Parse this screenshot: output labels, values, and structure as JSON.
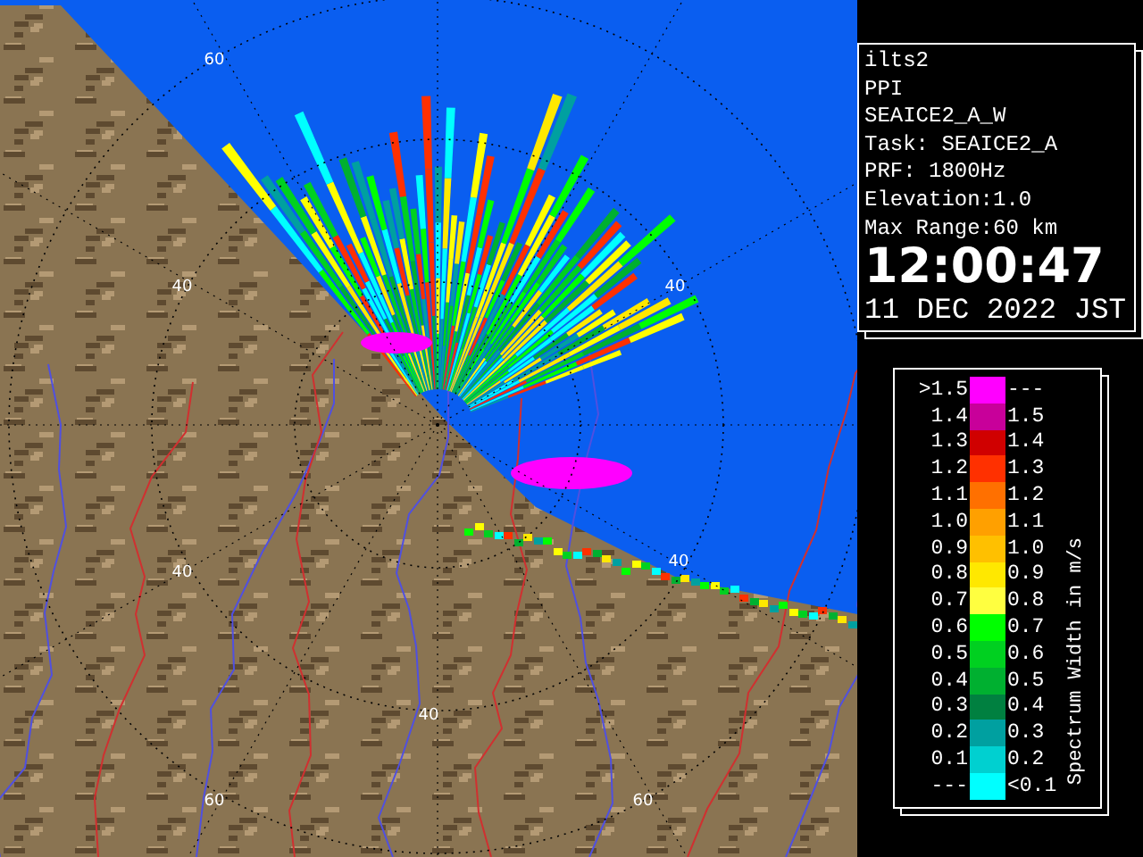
{
  "map": {
    "range_labels": [
      "60",
      "40",
      "40",
      "40",
      "40",
      "40",
      "60",
      "60"
    ]
  },
  "info": {
    "lines": [
      "ilts2",
      "PPI",
      "SEAICE2_A_W",
      "Task: SEAICE2_A",
      "PRF: 1800Hz",
      "Elevation:1.0",
      "Max Range:60 km"
    ],
    "time": "12:00:47",
    "date": "11 DEC 2022 JST"
  },
  "legend": {
    "title": "Spectrum Width in m/s",
    "rows": [
      {
        "low": ">1.5",
        "high": "---",
        "color": "#ff00ff"
      },
      {
        "low": "1.4",
        "high": "1.5",
        "color": "#c8009a"
      },
      {
        "low": "1.3",
        "high": "1.4",
        "color": "#d00000"
      },
      {
        "low": "1.2",
        "high": "1.3",
        "color": "#ff3000"
      },
      {
        "low": "1.1",
        "high": "1.2",
        "color": "#ff7000"
      },
      {
        "low": "1.0",
        "high": "1.1",
        "color": "#ffa000"
      },
      {
        "low": "0.9",
        "high": "1.0",
        "color": "#ffc000"
      },
      {
        "low": "0.8",
        "high": "0.9",
        "color": "#ffe800"
      },
      {
        "low": "0.7",
        "high": "0.8",
        "color": "#ffff40"
      },
      {
        "low": "0.6",
        "high": "0.7",
        "color": "#00ff00"
      },
      {
        "low": "0.5",
        "high": "0.6",
        "color": "#00d020"
      },
      {
        "low": "0.4",
        "high": "0.5",
        "color": "#00b030"
      },
      {
        "low": "0.3",
        "high": "0.4",
        "color": "#008040"
      },
      {
        "low": "0.2",
        "high": "0.3",
        "color": "#00a0a0"
      },
      {
        "low": "0.1",
        "high": "0.2",
        "color": "#00d0d0"
      },
      {
        "low": "---",
        "high": "<0.1",
        "color": "#00ffff"
      }
    ]
  }
}
